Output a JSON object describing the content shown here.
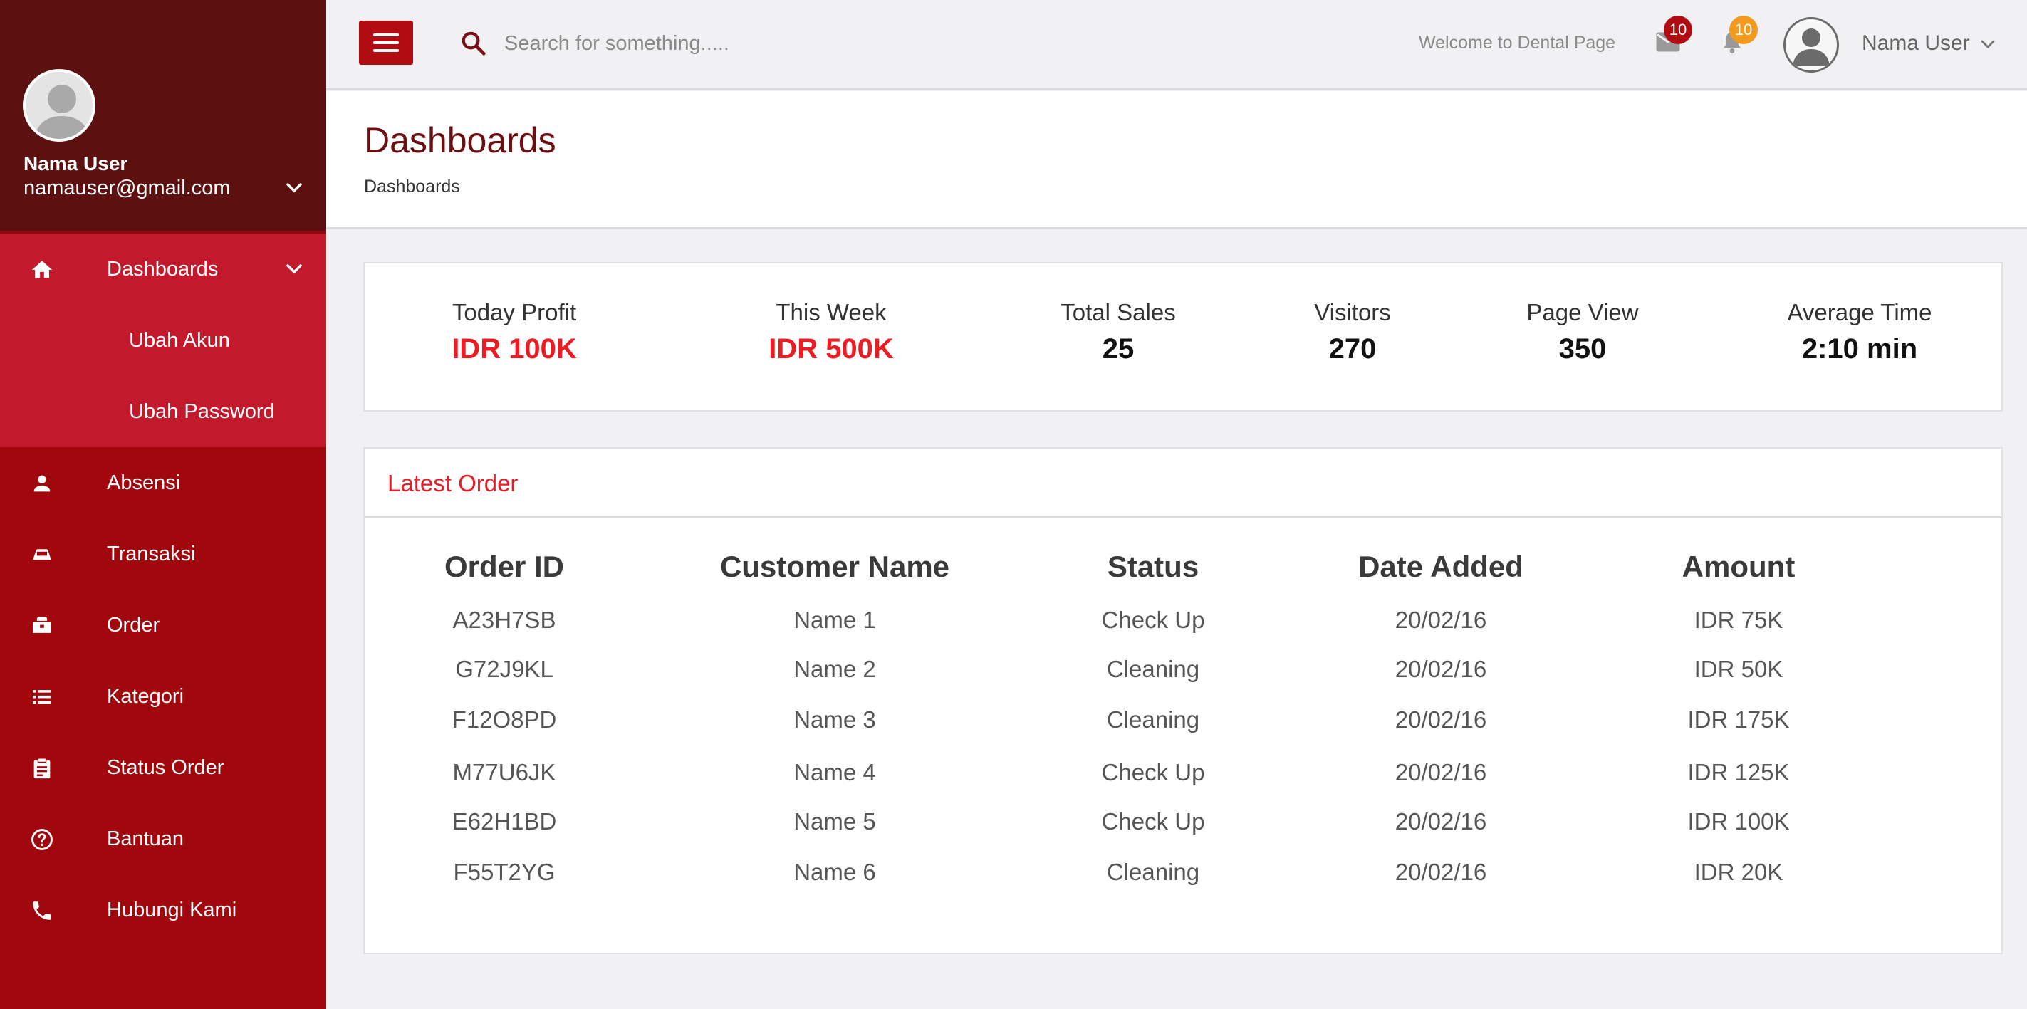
{
  "sidebar": {
    "profile": {
      "name": "Nama User",
      "email": "namauser@gmail.com"
    },
    "items": [
      {
        "label": "Dashboards",
        "icon": "home-icon"
      },
      {
        "label": "Absensi",
        "icon": "person-icon"
      },
      {
        "label": "Transaksi",
        "icon": "car-icon"
      },
      {
        "label": "Order",
        "icon": "briefcase-icon"
      },
      {
        "label": "Kategori",
        "icon": "list-icon"
      },
      {
        "label": "Status Order",
        "icon": "clipboard-icon"
      },
      {
        "label": "Bantuan",
        "icon": "help-icon"
      },
      {
        "label": "Hubungi Kami",
        "icon": "phone-icon"
      }
    ],
    "subitems": [
      {
        "label": "Ubah Akun"
      },
      {
        "label": "Ubah Password"
      }
    ],
    "colors": {
      "bg": "#a0080e",
      "profile_bg": "#5c1010",
      "submenu_bg": "#c21a2c"
    }
  },
  "topbar": {
    "search_placeholder": "Search for something.....",
    "welcome": "Welcome to Dental Page",
    "mail_count": "10",
    "bell_count": "10",
    "user_name": "Nama User"
  },
  "header": {
    "title": "Dashboards",
    "breadcrumb": "Dashboards"
  },
  "stats": [
    {
      "label": "Today Profit",
      "value": "IDR 100K"
    },
    {
      "label": "This Week",
      "value": "IDR 500K"
    },
    {
      "label": "Total Sales",
      "value": "25"
    },
    {
      "label": "Visitors",
      "value": "270"
    },
    {
      "label": "Page View",
      "value": "350"
    },
    {
      "label": "Average Time",
      "value": "2:10 min"
    }
  ],
  "orders": {
    "title": "Latest Order",
    "columns": [
      "Order ID",
      "Customer Name",
      "Status",
      "Date Added",
      "Amount"
    ],
    "rows": [
      [
        "A23H7SB",
        "Name 1",
        "Check Up",
        "20/02/16",
        "IDR 75K"
      ],
      [
        "G72J9KL",
        "Name 2",
        "Cleaning",
        "20/02/16",
        "IDR 50K"
      ],
      [
        "F12O8PD",
        "Name 3",
        "Cleaning",
        "20/02/16",
        "IDR 175K"
      ],
      [
        "M77U6JK",
        "Name 4",
        "Check Up",
        "20/02/16",
        "IDR 125K"
      ],
      [
        "E62H1BD",
        "Name 5",
        "Check Up",
        "20/02/16",
        "IDR 100K"
      ],
      [
        "F55T2YG",
        "Name 6",
        "Cleaning",
        "20/02/16",
        "IDR 20K"
      ]
    ]
  },
  "colors": {
    "accent": "#ec1c24",
    "brand_dark": "#6b0f12",
    "badge_mail": "#b00c12",
    "badge_bell": "#f29a1e"
  }
}
